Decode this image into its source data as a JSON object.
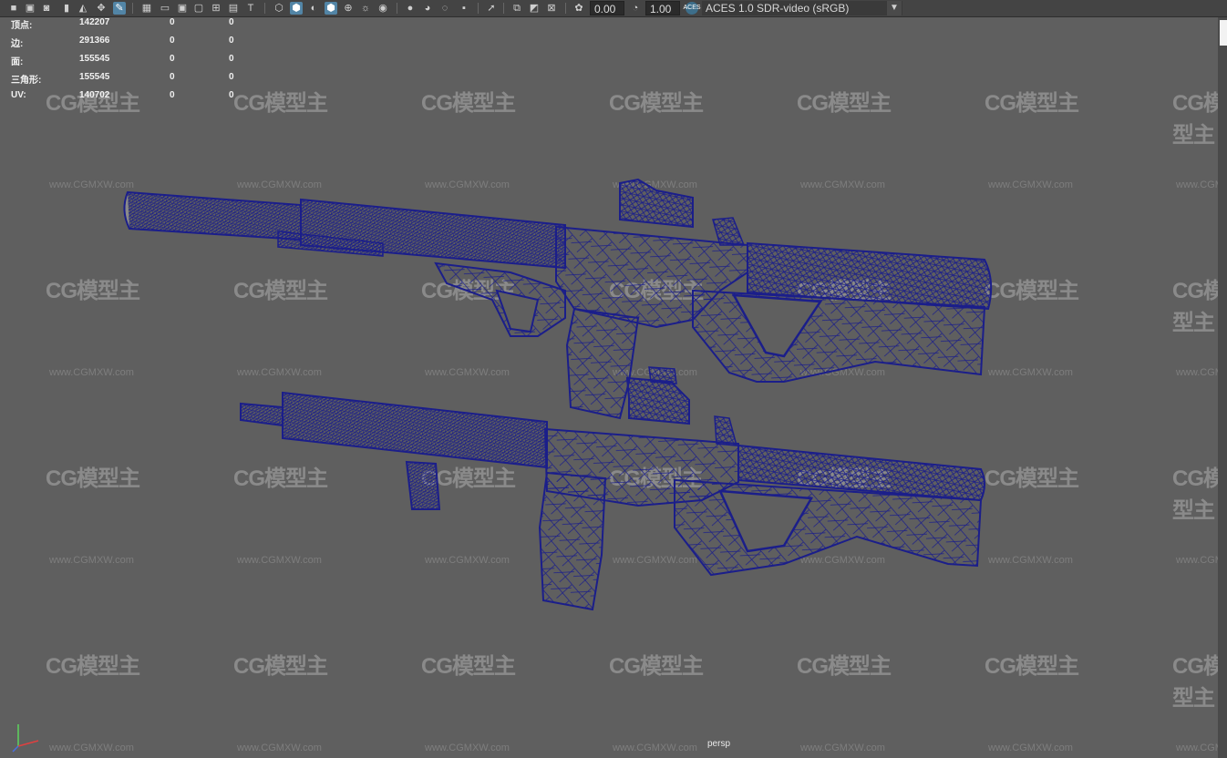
{
  "toolbar": {
    "icons": [
      "camera-icon",
      "camera-attr-icon",
      "bookmark-icon",
      "image-plane-icon",
      "grid-lock-icon",
      "pan-zoom-icon",
      "grease-pencil-icon",
      "grid-icon",
      "film-gate-icon",
      "resolution-gate-icon",
      "gate-mask-icon",
      "field-chart-icon",
      "safe-action-icon",
      "safe-title-icon",
      "wireframe-icon",
      "smooth-shade-icon",
      "default-material-icon",
      "textured-icon",
      "xray-icon",
      "use-lights-icon",
      "shadows-icon",
      "screen-space-ao-icon",
      "motion-blur-icon",
      "multisample-aa-icon",
      "depth-of-field-icon",
      "isolate-select-icon",
      "xray-joints-icon",
      "xray-active-icon",
      "backface-icon",
      "exposure-icon",
      "gamma-icon"
    ],
    "exposure_value": "0.00",
    "gamma_value": "1.00",
    "color_space": "ACES 1.0 SDR-video (sRGB)"
  },
  "hud": {
    "rows": [
      {
        "label": "顶点:",
        "c1": "142207",
        "c2": "0",
        "c3": "0"
      },
      {
        "label": "边:",
        "c1": "291366",
        "c2": "0",
        "c3": "0"
      },
      {
        "label": "面:",
        "c1": "155545",
        "c2": "0",
        "c3": "0"
      },
      {
        "label": "三角形:",
        "c1": "155545",
        "c2": "0",
        "c3": "0"
      },
      {
        "label": "UV:",
        "c1": "140702",
        "c2": "0",
        "c3": "0"
      }
    ]
  },
  "watermark": {
    "logo": "CG模型主",
    "url": "www.CGMXW.com"
  },
  "viewport": {
    "camera": "persp"
  },
  "colors": {
    "wireframe": "#1b1e8a",
    "background": "#5f5f5f",
    "active_icon": "#5285a6"
  }
}
